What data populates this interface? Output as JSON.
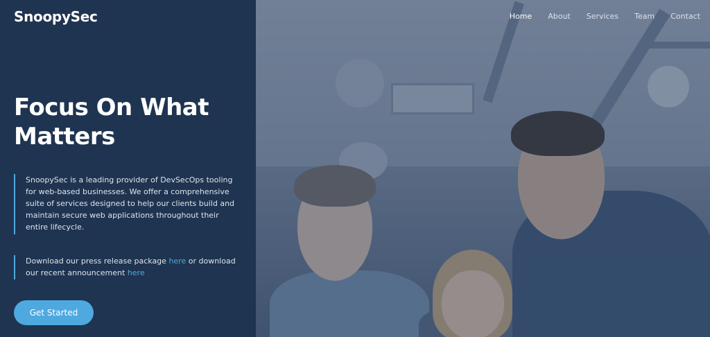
{
  "brand": "SnoopySec",
  "nav": {
    "items": [
      "Home",
      "About",
      "Services",
      "Team",
      "Contact"
    ],
    "active": "Home"
  },
  "hero": {
    "headline": "Focus On What Matters",
    "description": "SnoopySec is a leading provider of DevSecOps tooling for web-based businesses. We offer a comprehensive suite of services designed to help our clients build and maintain secure web applications throughout their entire lifecycle.",
    "download": {
      "part1": "Download our press release package ",
      "link1": "here",
      "part2": " or download our recent announcement ",
      "link2": "here"
    },
    "cta_label": "Get Started"
  },
  "colors": {
    "panel": "#1f3450",
    "accent": "#4ea9e0",
    "text": "#ffffff"
  },
  "image": {
    "description_icon": "team-photo"
  }
}
